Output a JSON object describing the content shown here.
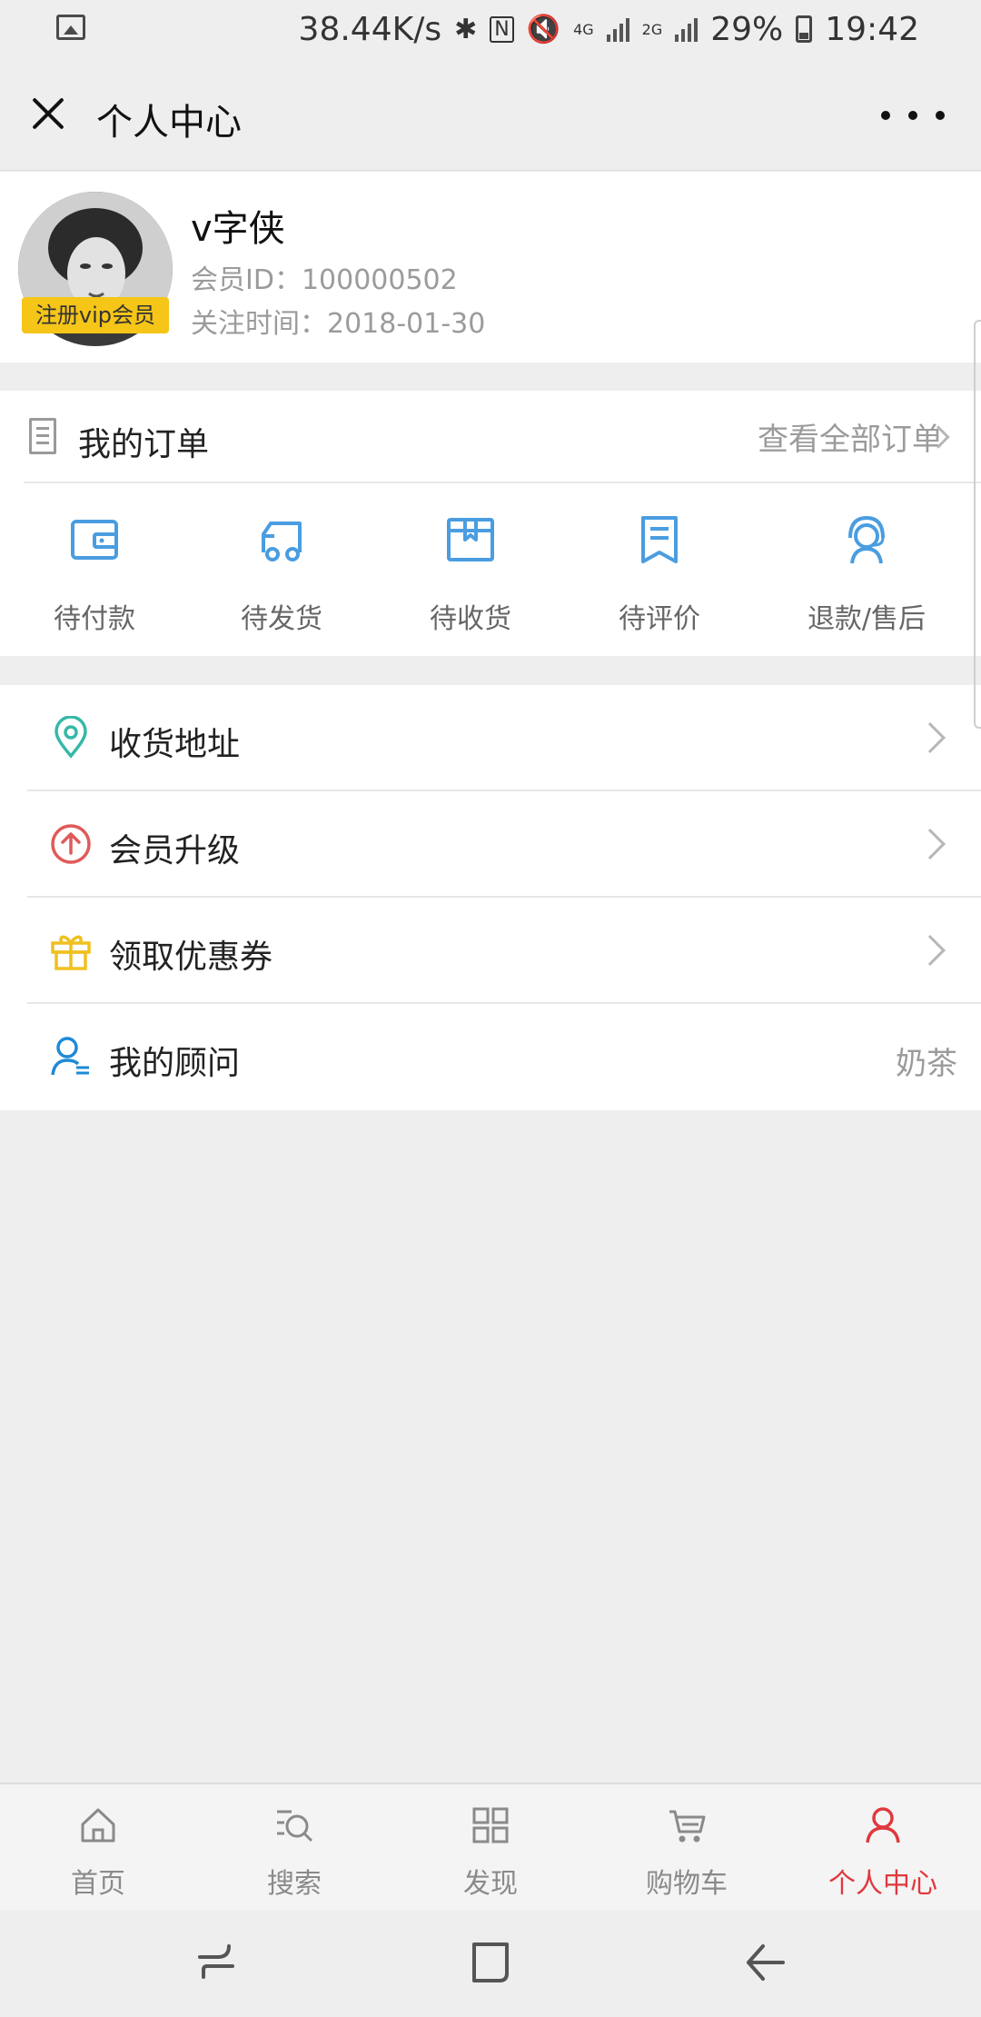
{
  "status_bar": {
    "speed": "38.44K/s",
    "network_4g": "4G",
    "network_2g": "2G",
    "battery_percent": "29%",
    "battery_level": 0.29,
    "time": "19:42",
    "icons": [
      "image-icon",
      "bluetooth-icon",
      "nfc-icon",
      "mute-icon",
      "signal-icon",
      "battery-icon"
    ]
  },
  "header": {
    "title": "个人中心",
    "close_icon": "close-icon",
    "more_icon": "more-dots-icon"
  },
  "profile": {
    "name": "v字侠",
    "member_id": "会员ID：100000502",
    "follow_time": "关注时间：2018-01-30",
    "vip_badge": "注册vip会员"
  },
  "orders": {
    "title": "我的订单",
    "view_all": "查看全部订单",
    "accent": "#4a9de0",
    "items": [
      {
        "label": "待付款",
        "icon": "wallet-icon"
      },
      {
        "label": "待发货",
        "icon": "truck-icon"
      },
      {
        "label": "待收货",
        "icon": "package-icon"
      },
      {
        "label": "待评价",
        "icon": "review-icon"
      },
      {
        "label": "退款/售后",
        "icon": "customer-service-icon"
      }
    ]
  },
  "menu": [
    {
      "label": "收货地址",
      "icon": "location-pin-icon",
      "color": "#35b8a8",
      "value": ""
    },
    {
      "label": "会员升级",
      "icon": "upgrade-arrow-icon",
      "color": "#e05a5a",
      "value": ""
    },
    {
      "label": "领取优惠券",
      "icon": "gift-icon",
      "color": "#f0c020",
      "value": ""
    },
    {
      "label": "我的顾问",
      "icon": "advisor-icon",
      "color": "#1e8ad6",
      "value": "奶茶"
    }
  ],
  "tabbar": {
    "active_color": "#e0383e",
    "items": [
      {
        "label": "首页",
        "icon": "home-icon"
      },
      {
        "label": "搜索",
        "icon": "search-icon"
      },
      {
        "label": "发现",
        "icon": "grid-icon"
      },
      {
        "label": "购物车",
        "icon": "cart-icon"
      },
      {
        "label": "个人中心",
        "icon": "user-icon"
      }
    ]
  },
  "navbar": {
    "icons": [
      "recents-icon",
      "home-square-icon",
      "back-icon"
    ]
  }
}
